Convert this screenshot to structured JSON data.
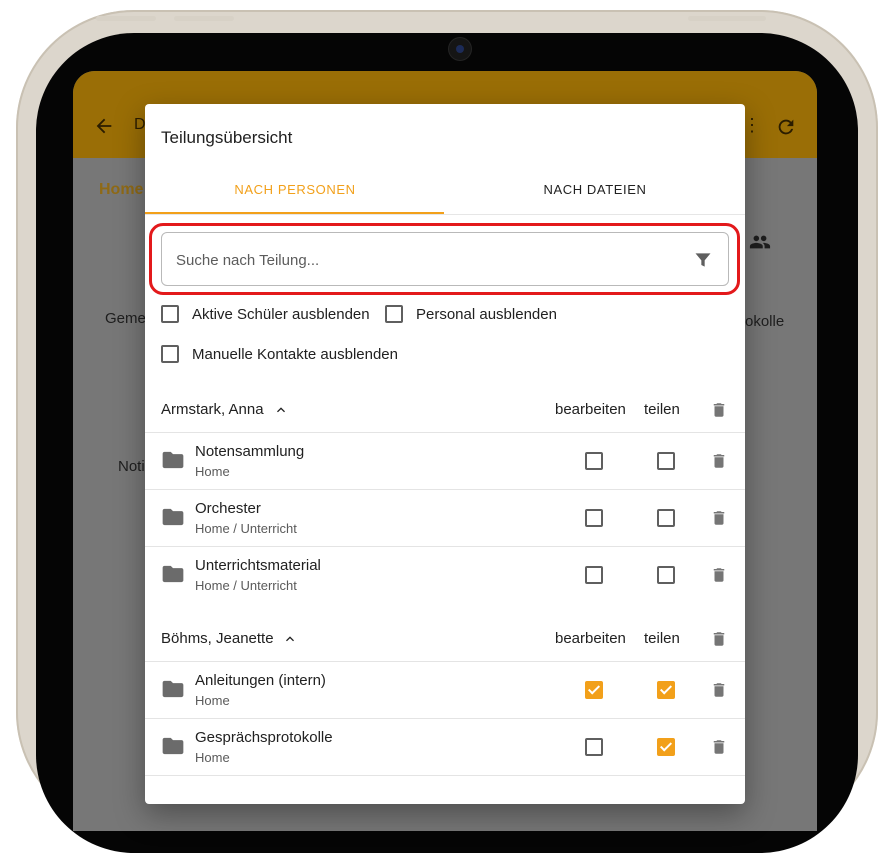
{
  "background": {
    "appbar_title_fragment": "D",
    "home_label": "Home",
    "fragments": {
      "left_top": "Geme",
      "right_top": "okolle",
      "left_mid": "Noti"
    }
  },
  "dialog": {
    "title": "Teilungsübersicht",
    "tabs": [
      {
        "label": "NACH PERSONEN",
        "active": true
      },
      {
        "label": "NACH DATEIEN",
        "active": false
      }
    ],
    "search": {
      "placeholder": "Suche nach Teilung...",
      "value": ""
    },
    "options": [
      {
        "label": "Aktive Schüler ausblenden",
        "checked": false
      },
      {
        "label": "Personal ausblenden",
        "checked": false
      },
      {
        "label": "Manuelle Kontakte ausblenden",
        "checked": false
      }
    ],
    "column_edit": "bearbeiten",
    "column_share": "teilen",
    "groups": [
      {
        "name": "Armstark, Anna",
        "items": [
          {
            "name": "Notensammlung",
            "path": "Home",
            "edit": false,
            "share": false
          },
          {
            "name": "Orchester",
            "path": "Home / Unterricht",
            "edit": false,
            "share": false
          },
          {
            "name": "Unterrichtsmaterial",
            "path": "Home / Unterricht",
            "edit": false,
            "share": false
          }
        ]
      },
      {
        "name": "Böhms, Jeanette",
        "items": [
          {
            "name": "Anleitungen (intern)",
            "path": "Home",
            "edit": true,
            "share": true
          },
          {
            "name": "Gesprächsprotokolle",
            "path": "Home",
            "edit": false,
            "share": true
          }
        ]
      }
    ]
  },
  "colors": {
    "accent": "#f2a01a",
    "highlight": "#e3191b",
    "appbar_dimmed": "#9a6e06",
    "scrim_bg": "#777777"
  },
  "icons": [
    "back-arrow-icon",
    "more-vert-icon",
    "refresh-icon",
    "people-icon",
    "filter-icon",
    "chevron-up-icon",
    "trash-icon",
    "folder-icon"
  ]
}
